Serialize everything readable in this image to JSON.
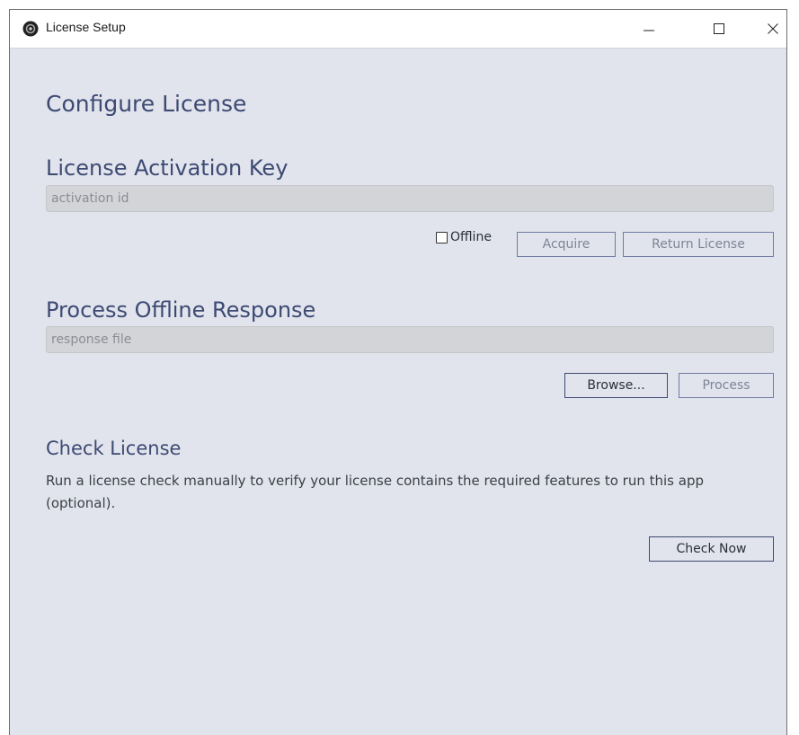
{
  "window": {
    "title": "License Setup",
    "controls": {
      "minimize": "minimize",
      "maximize": "maximize",
      "close": "close"
    }
  },
  "page": {
    "title": "Configure License"
  },
  "activation": {
    "heading": "License Activation Key",
    "input_placeholder": "activation id",
    "input_value": "",
    "offline_label": "Offline",
    "offline_checked": false,
    "acquire_label": "Acquire",
    "return_label": "Return License"
  },
  "offline_response": {
    "heading": "Process Offline Response",
    "input_placeholder": "response file",
    "input_value": "",
    "browse_label": "Browse...",
    "process_label": "Process"
  },
  "check": {
    "heading": "Check License",
    "description": "Run a license check manually to verify your license contains the required features to run this app (optional).",
    "button_label": "Check Now"
  },
  "colors": {
    "accent": "#3d4a73",
    "background": "#e1e4ec",
    "field_bg": "#d3d4d7"
  },
  "icons": {
    "app": "app-logo-icon",
    "minimize": "minimize-icon",
    "maximize": "maximize-icon",
    "close": "close-icon"
  }
}
